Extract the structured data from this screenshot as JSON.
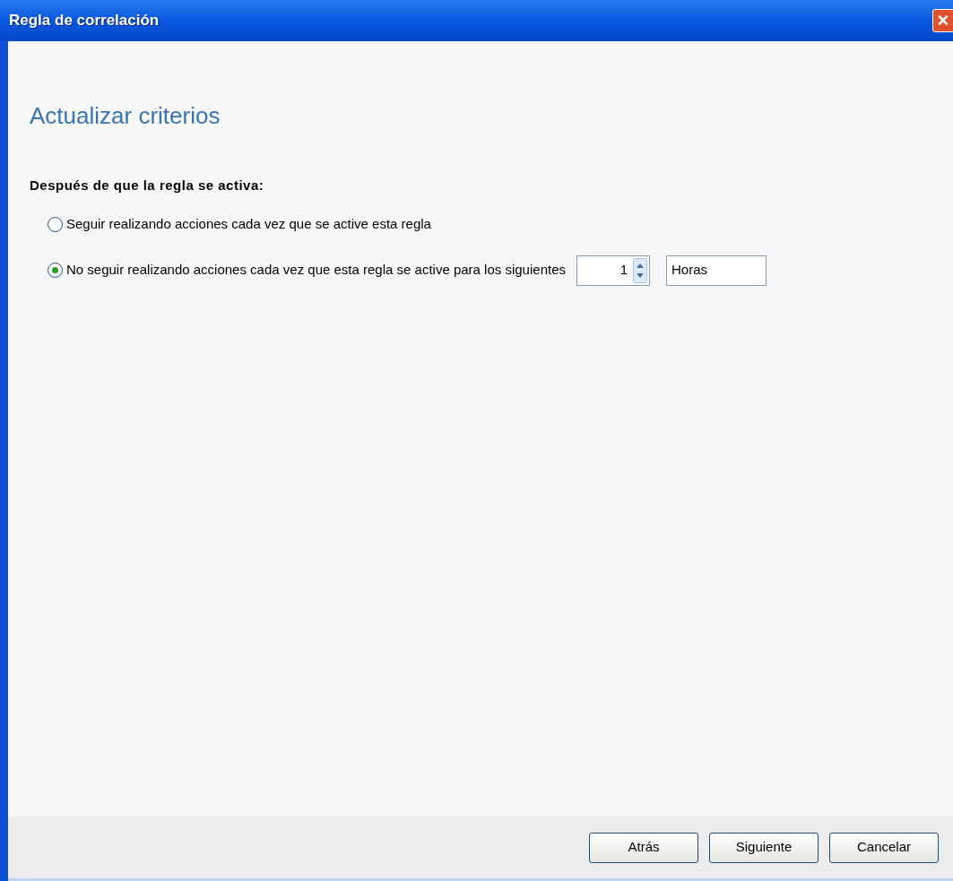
{
  "window": {
    "title": "Regla de correlación",
    "close": "×"
  },
  "heading": "Actualizar criterios",
  "section_label": "Después de que la regla se activa:",
  "options": [
    {
      "label": "Seguir realizando acciones cada vez que se active esta regla",
      "selected": false
    },
    {
      "label": "No seguir realizando acciones cada vez que esta regla se active para los siguientes",
      "selected": true
    }
  ],
  "duration": {
    "value": "1",
    "unit": "Horas"
  },
  "buttons": [
    "Atrás",
    "Siguiente",
    "Cancelar"
  ]
}
